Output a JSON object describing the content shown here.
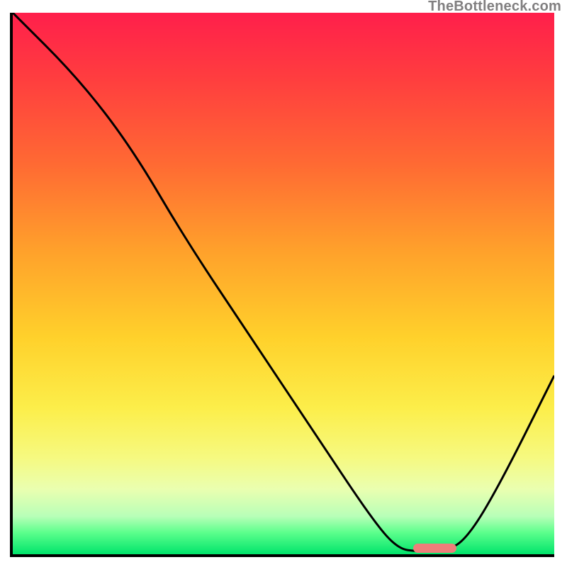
{
  "watermark": "TheBottleneck.com",
  "colors": {
    "gradient_top": "#ff1f4b",
    "gradient_bottom": "#00e46b",
    "axis": "#000000",
    "curve": "#000000",
    "marker": "#ee7e7a",
    "watermark_text": "#817f80"
  },
  "chart_data": {
    "type": "line",
    "title": "",
    "xlabel": "",
    "ylabel": "",
    "ylim": [
      0,
      100
    ],
    "xlim": [
      0,
      100
    ],
    "series": [
      {
        "name": "bottleneck-curve",
        "points": [
          {
            "x": 0.0,
            "y": 100.0
          },
          {
            "x": 12.0,
            "y": 88.0
          },
          {
            "x": 22.0,
            "y": 75.0
          },
          {
            "x": 32.0,
            "y": 58.0
          },
          {
            "x": 44.0,
            "y": 40.0
          },
          {
            "x": 56.0,
            "y": 22.0
          },
          {
            "x": 66.0,
            "y": 7.0
          },
          {
            "x": 71.0,
            "y": 1.0
          },
          {
            "x": 75.0,
            "y": 0.5
          },
          {
            "x": 80.0,
            "y": 0.5
          },
          {
            "x": 84.0,
            "y": 3.0
          },
          {
            "x": 90.0,
            "y": 13.0
          },
          {
            "x": 100.0,
            "y": 33.0
          }
        ]
      }
    ],
    "marker": {
      "name": "optimal-range",
      "x_start": 74.0,
      "x_end": 82.0,
      "y": 1.0
    }
  }
}
